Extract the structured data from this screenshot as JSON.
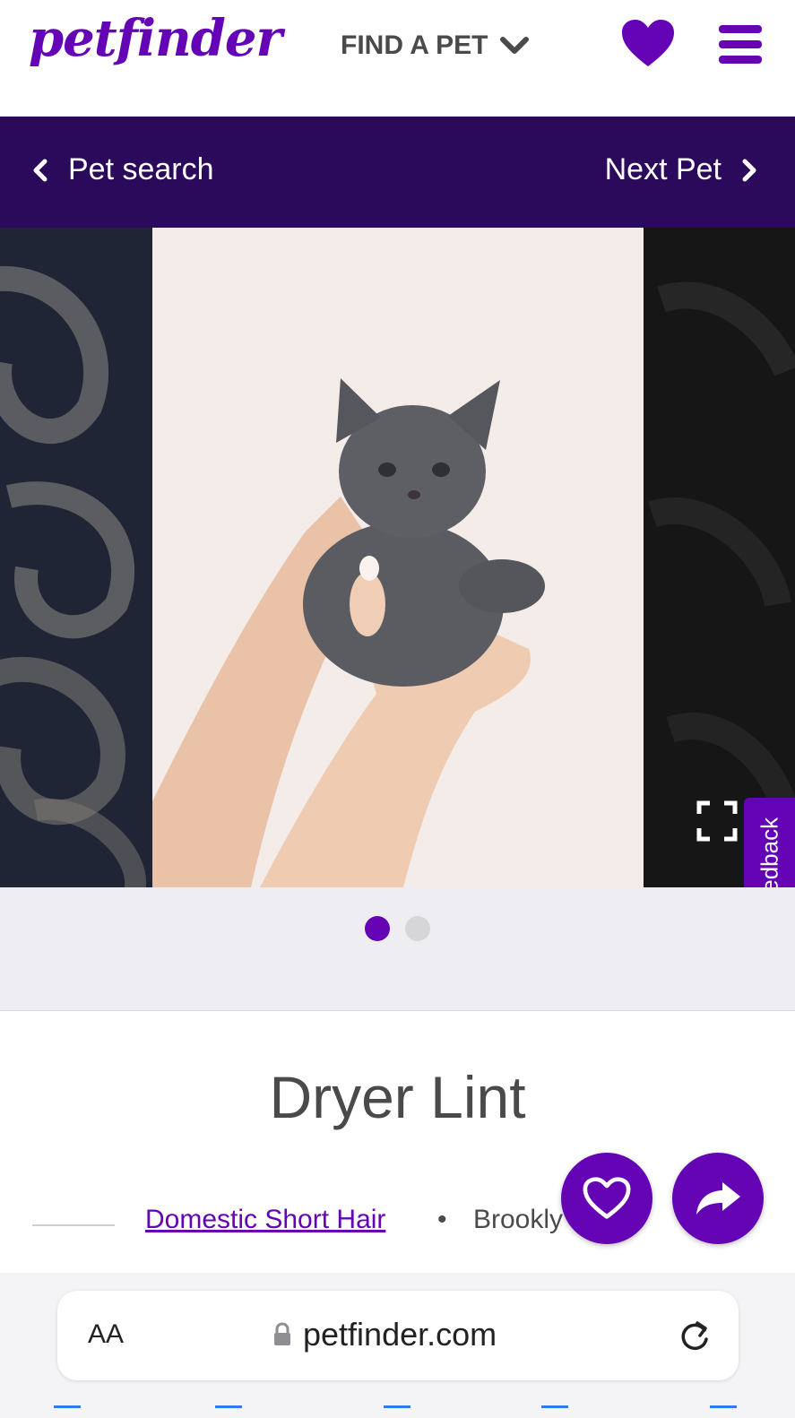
{
  "header": {
    "logo": "petfinder",
    "find_pet_label": "FIND A PET"
  },
  "nav": {
    "prev_label": "Pet search",
    "next_label": "Next Pet"
  },
  "carousel": {
    "slide_count": 2,
    "active_slide": 1,
    "feedback_label": "Feedback"
  },
  "pet": {
    "name": "Dryer Lint",
    "breed": "Domestic Short Hair",
    "separator": "•",
    "location": "Brookly"
  },
  "browser": {
    "text_size_label": "AA",
    "url": "petfinder.com"
  },
  "colors": {
    "brand_purple": "#6504b5",
    "nav_bar": "#2b0a5c"
  },
  "icons": [
    "chevron-down-icon",
    "heart-icon",
    "menu-icon",
    "chevron-left-icon",
    "chevron-right-icon",
    "expand-icon",
    "share-icon",
    "lock-icon",
    "reload-icon"
  ]
}
